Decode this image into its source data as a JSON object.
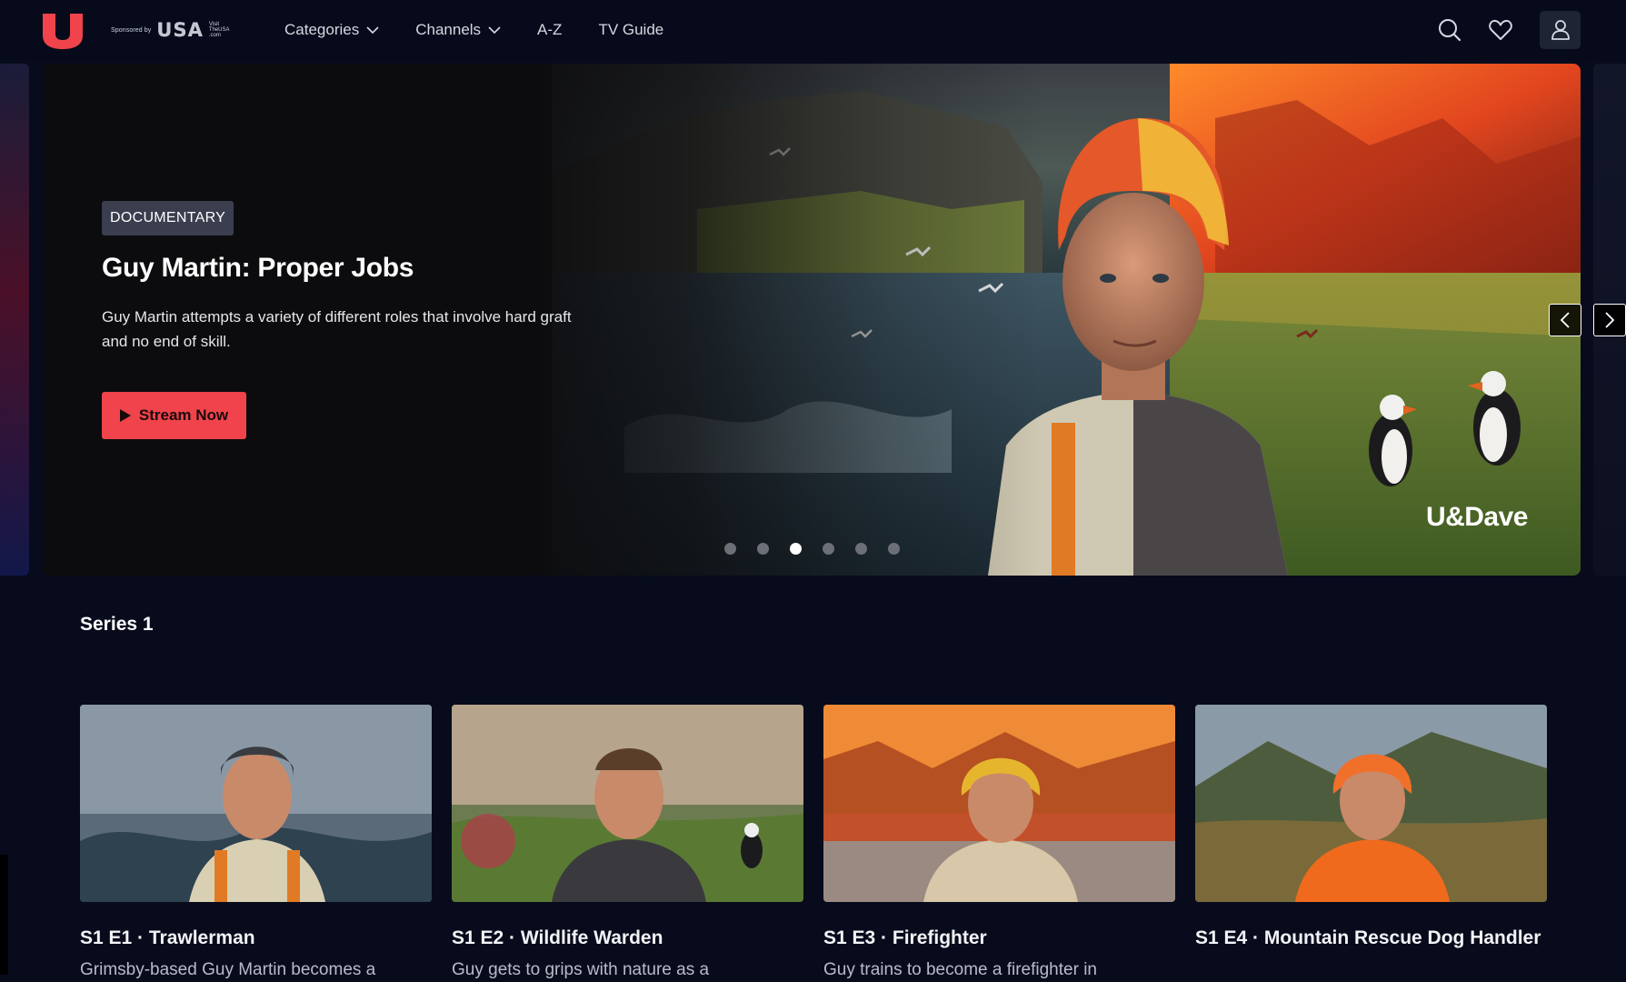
{
  "header": {
    "sponsor_text": "Sponsored by",
    "sponsor_brand": "USA",
    "sponsor_visit": "Visit TheUSA .com",
    "nav": [
      {
        "label": "Categories",
        "has_dropdown": true
      },
      {
        "label": "Channels",
        "has_dropdown": true
      },
      {
        "label": "A-Z",
        "has_dropdown": false
      },
      {
        "label": "TV Guide",
        "has_dropdown": false
      }
    ],
    "icons": [
      "search-icon",
      "heart-icon",
      "user-icon"
    ]
  },
  "hero": {
    "badge": "DOCUMENTARY",
    "title": "Guy Martin: Proper Jobs",
    "description": "Guy Martin attempts a variety of different roles that involve hard graft and no end of skill.",
    "cta_label": "Stream Now",
    "channel_mark": "U&Dave",
    "slide_count": 6,
    "active_slide": 3
  },
  "series": {
    "title": "Series 1",
    "episodes": [
      {
        "title": "S1 E1 · Trawlerman",
        "description": "Grimsby-based Guy Martin becomes a"
      },
      {
        "title": "S1 E2 · Wildlife Warden",
        "description": "Guy gets to grips with nature as a"
      },
      {
        "title": "S1 E3 · Firefighter",
        "description": "Guy trains to become a firefighter in"
      },
      {
        "title": "S1 E4 · Mountain Rescue Dog Handler",
        "description": ""
      }
    ]
  },
  "colors": {
    "background": "#070b1c",
    "accent": "#f0434b",
    "badge_bg": "#3a3e4e"
  }
}
